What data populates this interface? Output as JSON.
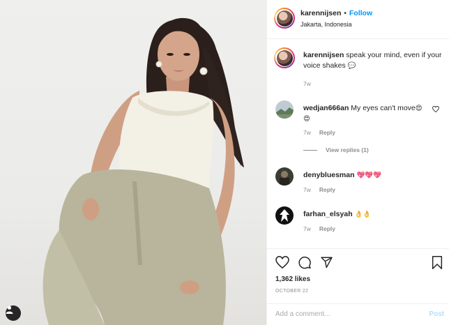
{
  "post": {
    "username": "karennijsen",
    "dot": "•",
    "follow_label": "Follow",
    "location": "Jakarta, Indonesia"
  },
  "caption": {
    "username": "karennijsen",
    "text": "speak your mind, even if your voice shakes",
    "emoji": "💬",
    "time": "7w"
  },
  "comments": [
    {
      "username": "wedjan666an",
      "text": "My eyes can't move",
      "emoji": "😍😍",
      "time": "7w",
      "reply_label": "Reply"
    },
    {
      "username": "denybluesman",
      "text": "",
      "emoji": "💖💖💖",
      "time": "7w",
      "reply_label": "Reply"
    },
    {
      "username": "farhan_elsyah",
      "text": "",
      "emoji": "👌👌",
      "time": "7w",
      "reply_label": "Reply"
    }
  ],
  "view_replies_label": "View replies (1)",
  "actions": {
    "like_icon": "heart-icon",
    "comment_icon": "comment-icon",
    "share_icon": "paper-plane-icon",
    "save_icon": "bookmark-icon"
  },
  "likes": "1,362 likes",
  "date": "OCTOBER 22",
  "add_comment": {
    "placeholder": "Add a comment...",
    "post_label": "Post"
  },
  "colors": {
    "accent": "#0095f6",
    "muted": "#8e8e8e",
    "post_disabled": "#b2dffc"
  }
}
